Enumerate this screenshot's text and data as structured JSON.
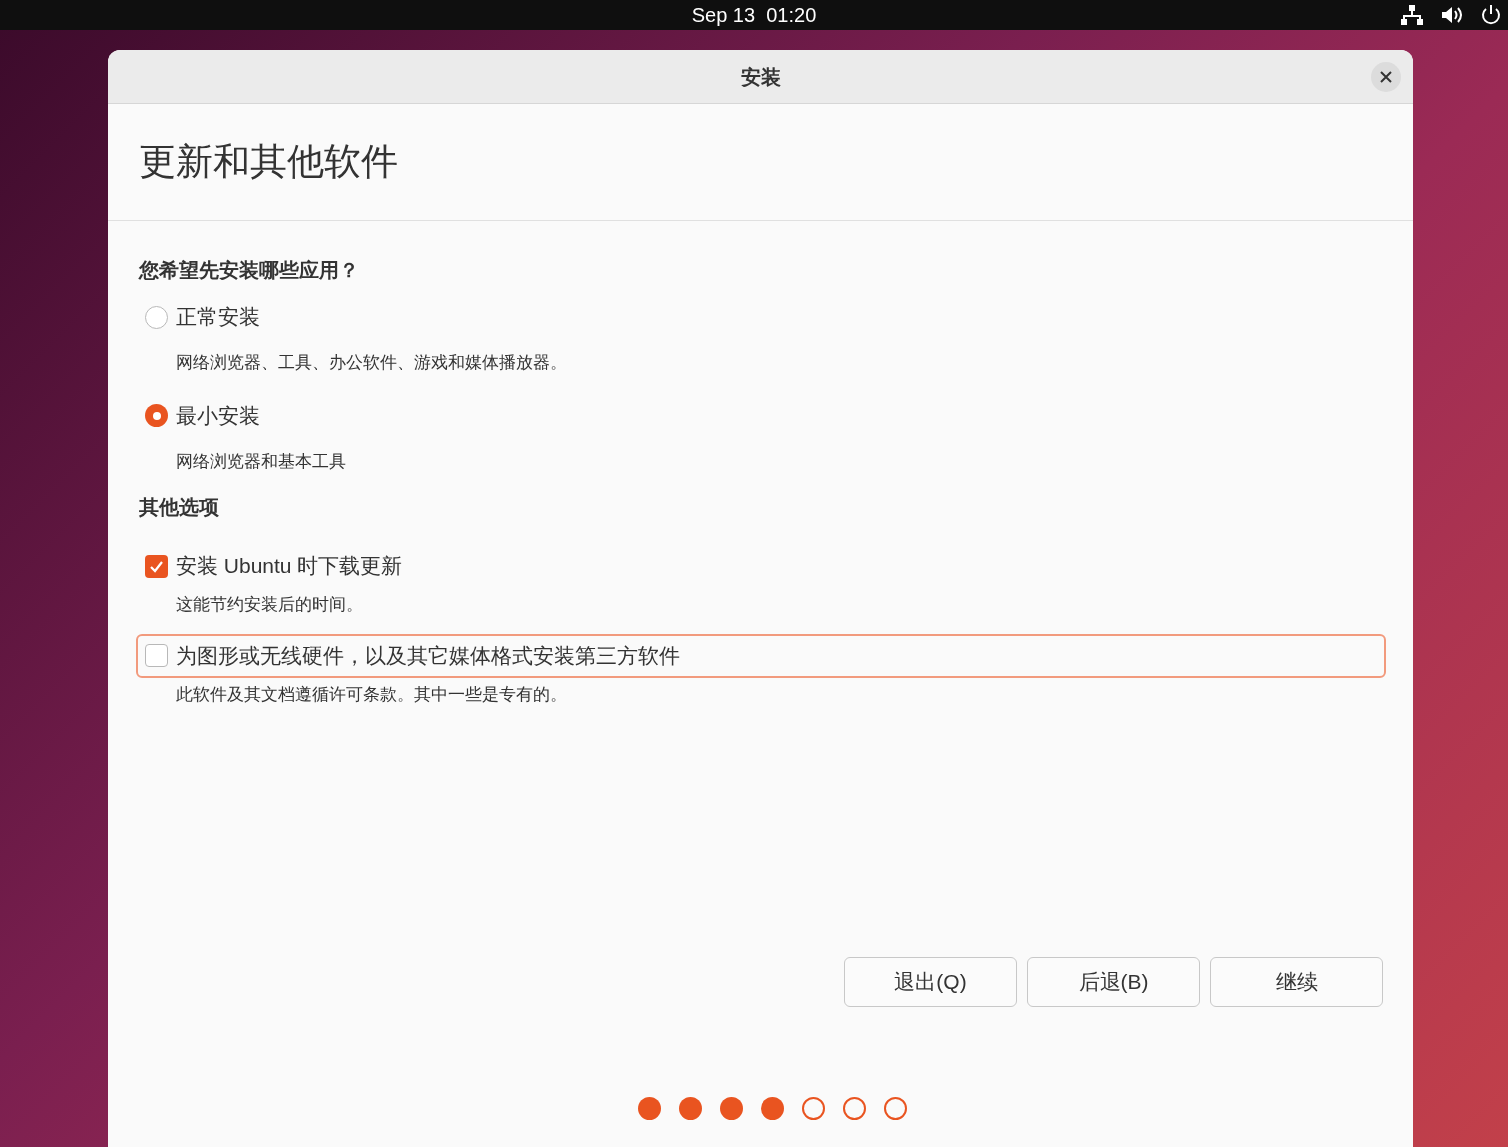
{
  "top_bar": {
    "clock": "Sep 13  01:20"
  },
  "window": {
    "title": "安装"
  },
  "page_title": "更新和其他软件",
  "sections": [
    {
      "heading": "您希望先安装哪些应用？",
      "options": [
        {
          "kind": "radio",
          "label": "正常安装",
          "selected": false,
          "focused": false,
          "description": "网络浏览器、工具、办公软件、游戏和媒体播放器。"
        },
        {
          "kind": "radio",
          "label": "最小安装",
          "selected": true,
          "focused": false,
          "description": "网络浏览器和基本工具"
        }
      ]
    },
    {
      "heading": "其他选项",
      "options": [
        {
          "kind": "checkbox",
          "label": "安装 Ubuntu 时下载更新",
          "checked": true,
          "focused": false,
          "description": "这能节约安装后的时间。"
        },
        {
          "kind": "checkbox",
          "label": "为图形或无线硬件，以及其它媒体格式安装第三方软件",
          "checked": false,
          "focused": true,
          "description": "此软件及其文档遵循许可条款。其中一些是专有的。"
        }
      ]
    }
  ],
  "buttons": [
    "退出(Q)",
    "后退(B)",
    "继续"
  ],
  "progress": [
    {
      "done": true
    },
    {
      "done": true
    },
    {
      "done": true
    },
    {
      "done": true
    },
    {
      "done": false
    },
    {
      "done": false
    },
    {
      "done": false
    }
  ]
}
